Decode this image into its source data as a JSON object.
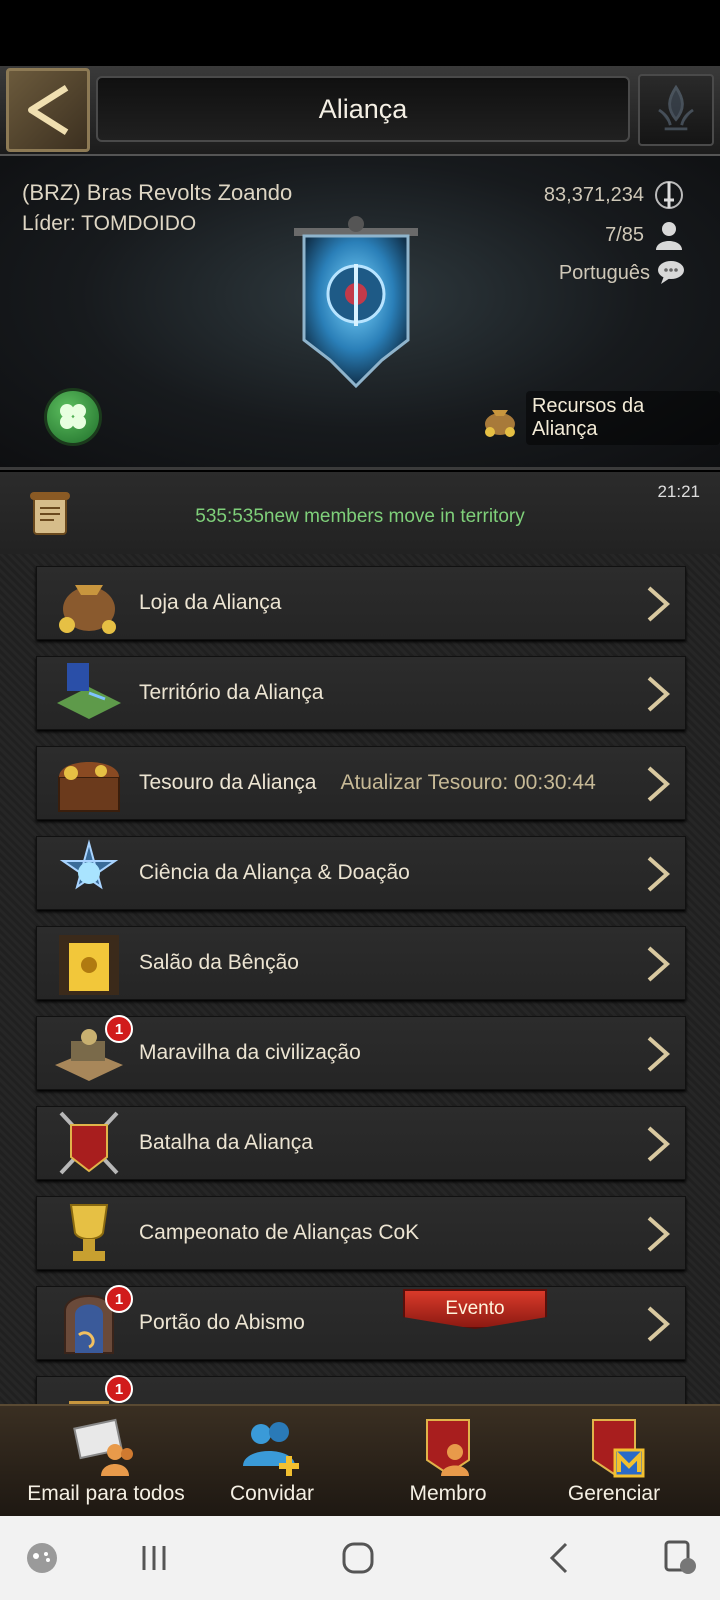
{
  "header": {
    "title": "Aliança"
  },
  "alliance": {
    "name": "(BRZ) Bras Revolts Zoando",
    "leader": "Líder: TOMDOIDO",
    "power": "83,371,234",
    "members": "7/85",
    "language": "Português",
    "resources_label": "Recursos da Aliança"
  },
  "news": {
    "time": "21:21",
    "text": "535:535new members move in territory"
  },
  "menu": [
    {
      "label": "Loja da Aliança",
      "extra": "",
      "badge": "",
      "icon": "shop-bag-icon"
    },
    {
      "label": "Território da Aliança",
      "extra": "",
      "badge": "",
      "icon": "territory-map-icon"
    },
    {
      "label": "Tesouro da Aliança",
      "extra": "Atualizar Tesouro: 00:30:44",
      "badge": "",
      "icon": "treasure-chest-icon"
    },
    {
      "label": "Ciência da Aliança & Doação",
      "extra": "",
      "badge": "",
      "icon": "science-star-icon"
    },
    {
      "label": "Salão da Bênção",
      "extra": "",
      "badge": "",
      "icon": "blessing-hall-icon"
    },
    {
      "label": "Maravilha da civilização",
      "extra": "",
      "badge": "1",
      "icon": "wonder-icon"
    },
    {
      "label": "Batalha da Aliança",
      "extra": "",
      "badge": "",
      "icon": "battle-shield-icon"
    },
    {
      "label": "Campeonato de Alianças CoK",
      "extra": "",
      "badge": "",
      "icon": "trophy-icon"
    },
    {
      "label": "Portão do Abismo",
      "extra": "",
      "badge": "1",
      "event": "Evento",
      "icon": "abyss-gate-icon"
    },
    {
      "label": "",
      "extra": "",
      "badge": "1",
      "icon": "partial-item-icon"
    }
  ],
  "tabs": [
    {
      "label": "Email para todos",
      "icon": "mail-group-icon"
    },
    {
      "label": "Convidar",
      "icon": "invite-icon"
    },
    {
      "label": "Membro",
      "icon": "member-icon"
    },
    {
      "label": "Gerenciar",
      "icon": "manage-icon"
    }
  ],
  "colors": {
    "news_text": "#7fd07a",
    "badge": "#d11b1b",
    "event": "#d93a2a"
  }
}
